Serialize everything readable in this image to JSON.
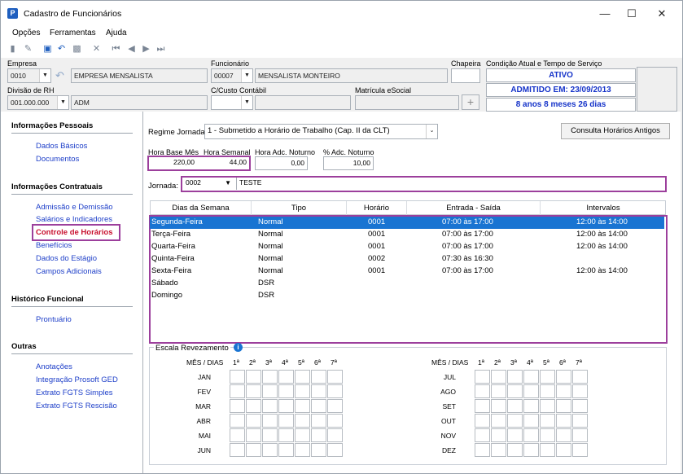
{
  "window": {
    "title": "Cadastro de Funcionários",
    "app_icon": "P"
  },
  "menu": [
    "Opções",
    "Ferramentas",
    "Ajuda"
  ],
  "header": {
    "empresa_label": "Empresa",
    "empresa_code": "0010",
    "empresa_name": "EMPRESA MENSALISTA",
    "funcionario_label": "Funcionário",
    "funcionario_code": "00007",
    "funcionario_name": "MENSALISTA MONTEIRO",
    "chapeira_label": "Chapeira",
    "chapeira_value": "",
    "divisao_label": "Divisão de RH",
    "divisao_code": "001.000.000",
    "divisao_name": "ADM",
    "custo_label": "C/Custo Contábil",
    "matricula_label": "Matrícula eSocial",
    "condicao_label": "Condição Atual e Tempo de Serviço",
    "status_ativo": "ATIVO",
    "status_admitido": "ADMITIDO EM: 23/09/2013",
    "status_tempo": "8 anos 8 meses 26 dias",
    "status_color": "#1533c9"
  },
  "sidebar": {
    "sections": [
      {
        "title": "Informações Pessoais",
        "items": [
          "Dados Básicos",
          "Documentos"
        ]
      },
      {
        "title": "Informações Contratuais",
        "items": [
          "Admissão e Demissão",
          "Salários e Indicadores",
          "Controle de Horários",
          "Benefícios",
          "Dados do Estágio",
          "Campos Adicionais"
        ]
      },
      {
        "title": "Histórico Funcional",
        "items": [
          "Prontuário"
        ]
      },
      {
        "title": "Outras",
        "items": [
          "Anotações",
          "Integração Prosoft GED",
          "Extrato FGTS Simples",
          "Extrato FGTS Rescisão"
        ]
      }
    ],
    "link_color": "#1f40c9",
    "active_color": "#c8102e"
  },
  "main": {
    "regime_label": "Regime Jornada",
    "regime_value": "1 - Submetido a Horário de Trabalho (Cap. II da CLT)",
    "consulta_button": "Consulta Horários Antigos",
    "hora_base_label": "Hora Base Mês",
    "hora_base_value": "220,00",
    "hora_semanal_label": "Hora Semanal",
    "hora_semanal_value": "44,00",
    "hora_noturno_label": "Hora Adc. Noturno",
    "hora_noturno_value": "0,00",
    "pct_noturno_label": "% Adc. Noturno",
    "pct_noturno_value": "10,00",
    "jornada_label": "Jornada:",
    "jornada_code": "0002",
    "jornada_name": "TESTE",
    "columns": [
      "Dias da Semana",
      "Tipo",
      "Horário",
      "Entrada - Saída",
      "Intervalos"
    ],
    "rows": [
      {
        "dia": "Segunda-Feira",
        "tipo": "Normal",
        "horario": "0001",
        "entrada": "07:00 às 17:00",
        "intervalo": "12:00 às 14:00"
      },
      {
        "dia": "Terça-Feira",
        "tipo": "Normal",
        "horario": "0001",
        "entrada": "07:00 às 17:00",
        "intervalo": "12:00 às 14:00"
      },
      {
        "dia": "Quarta-Feira",
        "tipo": "Normal",
        "horario": "0001",
        "entrada": "07:00 às 17:00",
        "intervalo": "12:00 às 14:00"
      },
      {
        "dia": "Quinta-Feira",
        "tipo": "Normal",
        "horario": "0002",
        "entrada": "07:30 às 16:30",
        "intervalo": ""
      },
      {
        "dia": "Sexta-Feira",
        "tipo": "Normal",
        "horario": "0001",
        "entrada": "07:00 às 17:00",
        "intervalo": "12:00 às 14:00"
      },
      {
        "dia": "Sábado",
        "tipo": "DSR",
        "horario": "",
        "entrada": "",
        "intervalo": ""
      },
      {
        "dia": "Domingo",
        "tipo": "DSR",
        "horario": "",
        "entrada": "",
        "intervalo": ""
      }
    ],
    "escala_label": "Escala Revezamento",
    "mes_dias_label": "MÊS / DIAS",
    "week_labels": [
      "1ª",
      "2ª",
      "3ª",
      "4ª",
      "5ª",
      "6ª",
      "7ª"
    ],
    "months_left": [
      "JAN",
      "FEV",
      "MAR",
      "ABR",
      "MAI",
      "JUN"
    ],
    "months_right": [
      "JUL",
      "AGO",
      "SET",
      "OUT",
      "NOV",
      "DEZ"
    ]
  }
}
